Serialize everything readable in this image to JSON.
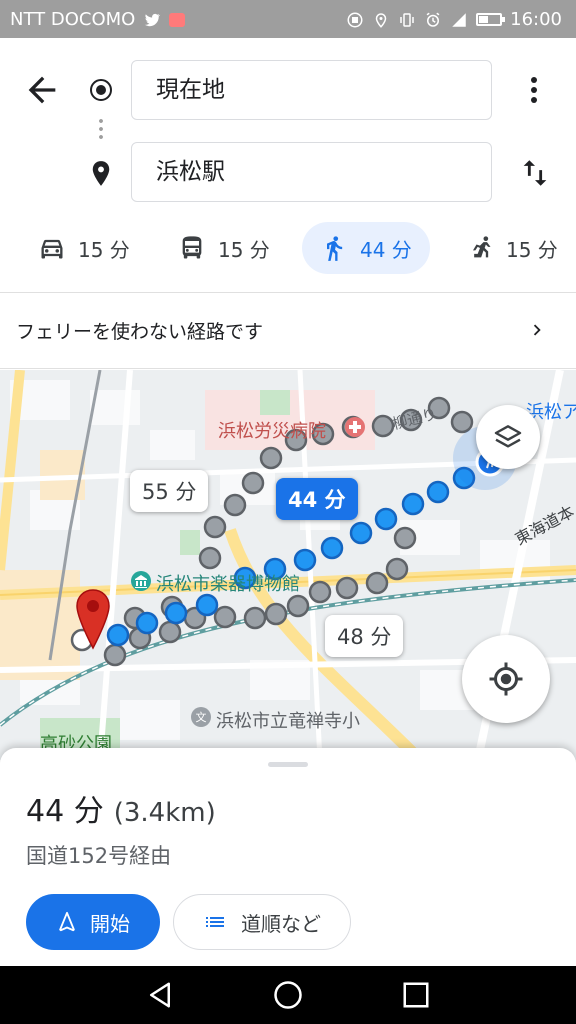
{
  "status_bar": {
    "carrier": "NTT DOCOMO",
    "time": "16:00"
  },
  "header": {
    "origin": "現在地",
    "destination": "浜松駅"
  },
  "modes": [
    {
      "name": "car",
      "label": "15 分",
      "icon": "car-icon"
    },
    {
      "name": "transit",
      "label": "15 分",
      "icon": "bus-icon"
    },
    {
      "name": "walk",
      "label": "44 分",
      "icon": "walk-icon",
      "selected": true
    },
    {
      "name": "ride",
      "label": "15 分",
      "icon": "ride-hailing-icon"
    }
  ],
  "notice": {
    "text": "フェリーを使わない経路です"
  },
  "map": {
    "labels": {
      "hospital": "浜松労災病院",
      "yanagi": "柳通り",
      "hamamatsu_top": "浜松ア",
      "highway": "東海道本",
      "museum": "浜松市楽器博物館",
      "school": "浜松市立竜禅寺小",
      "park": "高砂公園"
    },
    "route_bubbles": {
      "alt1": "55 分",
      "main": "44 分",
      "alt2": "48 分"
    },
    "colors": {
      "route": "#2196f3",
      "alt_route": "#9aa0a6",
      "accent": "#1a73e8",
      "pin": "#d93025"
    }
  },
  "summary": {
    "duration": "44 分",
    "distance": "(3.4km)",
    "via": "国道152号経由",
    "start_label": "開始",
    "steps_label": "道順など"
  }
}
